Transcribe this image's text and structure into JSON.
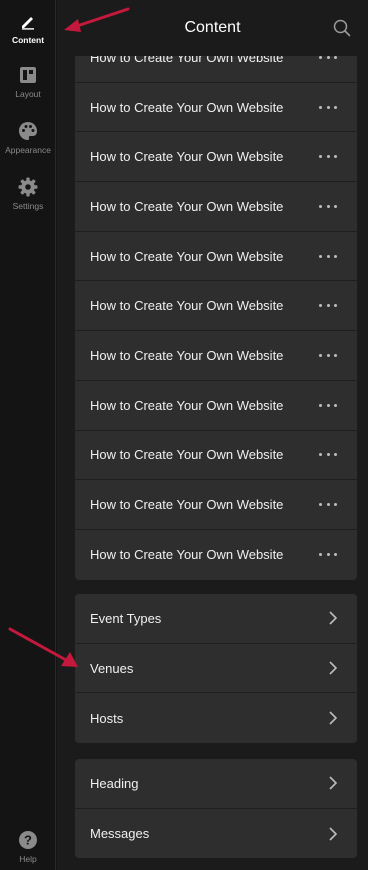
{
  "rail": {
    "items": [
      {
        "label": "Content",
        "icon": "pencil-icon"
      },
      {
        "label": "Layout",
        "icon": "layout-icon"
      },
      {
        "label": "Appearance",
        "icon": "palette-icon"
      },
      {
        "label": "Settings",
        "icon": "gear-icon"
      }
    ],
    "help": {
      "label": "Help",
      "icon": "help-icon"
    }
  },
  "header": {
    "title": "Content",
    "search_icon": "search-icon"
  },
  "articles": {
    "items": [
      "How to Create Your Own Website",
      "How to Create Your Own Website",
      "How to Create Your Own Website",
      "How to Create Your Own Website",
      "How to Create Your Own Website",
      "How to Create Your Own Website",
      "How to Create Your Own Website",
      "How to Create Your Own Website",
      "How to Create Your Own Website",
      "How to Create Your Own Website",
      "How to Create Your Own Website"
    ],
    "more_icon": "more-horizontal-icon"
  },
  "collections": {
    "items": [
      "Event Types",
      "Venues",
      "Hosts"
    ],
    "chevron_icon": "chevron-right-icon"
  },
  "sections": {
    "items": [
      "Heading",
      "Messages"
    ]
  },
  "colors": {
    "background": "#141414",
    "panel": "#1b1b1b",
    "card": "#2e2e2e",
    "annotation_arrow": "#c4183c"
  }
}
